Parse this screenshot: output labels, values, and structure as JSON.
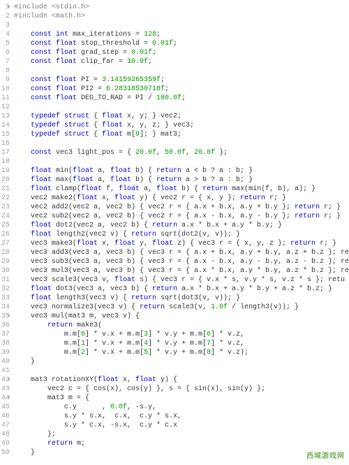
{
  "watermark": "西域游戏网",
  "lines": [
    {
      "n": 1,
      "fold": "▾",
      "html": "<span class='pp'>#include</span> <span class='str'>&lt;stdio.h&gt;</span>"
    },
    {
      "n": 2,
      "fold": "",
      "html": "<span class='pp'>#include</span> <span class='str'>&lt;math.h&gt;</span>"
    },
    {
      "n": 3,
      "fold": "",
      "html": ""
    },
    {
      "n": 4,
      "fold": "",
      "html": "    <span class='kw'>const</span> <span class='type'>int</span> max_iterations = <span class='num'>128</span>;"
    },
    {
      "n": 5,
      "fold": "",
      "html": "    <span class='kw'>const</span> <span class='type'>float</span> stop_threshold = <span class='num'>0.01f</span>;"
    },
    {
      "n": 6,
      "fold": "",
      "html": "    <span class='kw'>const</span> <span class='type'>float</span> grad_step = <span class='num'>0.01f</span>;"
    },
    {
      "n": 7,
      "fold": "",
      "html": "    <span class='kw'>const</span> <span class='type'>float</span> clip_far = <span class='num'>10.0f</span>;"
    },
    {
      "n": 8,
      "fold": "",
      "html": ""
    },
    {
      "n": 9,
      "fold": "",
      "html": "    <span class='kw'>const</span> <span class='type'>float</span> PI = <span class='num'>3.14159265359f</span>;"
    },
    {
      "n": 10,
      "fold": "",
      "html": "    <span class='kw'>const</span> <span class='type'>float</span> PI2 = <span class='num'>6.28318530718f</span>;"
    },
    {
      "n": 11,
      "fold": "",
      "html": "    <span class='kw'>const</span> <span class='type'>float</span> DEG_TO_RAD = PI / <span class='num'>180.0f</span>;"
    },
    {
      "n": 12,
      "fold": "",
      "html": ""
    },
    {
      "n": 13,
      "fold": "",
      "html": "    <span class='kw'>typedef</span> <span class='kw'>struct</span> { <span class='type'>float</span> x, y; } vec2;"
    },
    {
      "n": 14,
      "fold": "",
      "html": "    <span class='kw'>typedef</span> <span class='kw'>struct</span> { <span class='type'>float</span> x, y, z; } vec3;"
    },
    {
      "n": 15,
      "fold": "",
      "html": "    <span class='kw'>typedef</span> <span class='kw'>struct</span> { <span class='type'>float</span> m[<span class='num'>9</span>]; } mat3;"
    },
    {
      "n": 16,
      "fold": "",
      "html": ""
    },
    {
      "n": 17,
      "fold": "",
      "html": "    <span class='kw'>const</span> vec3 light_pos = { <span class='num'>20.0f</span>, <span class='num'>50.0f</span>, <span class='num'>20.0f</span> };"
    },
    {
      "n": 18,
      "fold": "",
      "html": ""
    },
    {
      "n": 19,
      "fold": "",
      "html": "    <span class='type'>float</span> min(<span class='type'>float</span> a, <span class='type'>float</span> b) { <span class='kw'>return</span> a &lt; b ? a : b; }"
    },
    {
      "n": 20,
      "fold": "",
      "html": "    <span class='type'>float</span> max(<span class='type'>float</span> a, <span class='type'>float</span> b) { <span class='kw'>return</span> a &gt; b ? a : b; }"
    },
    {
      "n": 21,
      "fold": "",
      "html": "    <span class='type'>float</span> clamp(<span class='type'>float</span> f, <span class='type'>float</span> a, <span class='type'>float</span> b) { <span class='kw'>return</span> max(min(f, b), a); }"
    },
    {
      "n": 22,
      "fold": "",
      "html": "    vec2 make2(<span class='type'>float</span> x, <span class='type'>float</span> y) { vec2 r = { x, y }; <span class='kw'>return</span> r; }"
    },
    {
      "n": 23,
      "fold": "",
      "html": "    vec2 add2(vec2 a, vec2 b) { vec2 r = { a.x + b.x, a.y + b.y }; <span class='kw'>return</span> r; }"
    },
    {
      "n": 24,
      "fold": "",
      "html": "    vec2 sub2(vec2 a, vec2 b) { vec2 r = { a.x - b.x, a.y - b.y }; <span class='kw'>return</span> r; }"
    },
    {
      "n": 25,
      "fold": "",
      "html": "    <span class='type'>float</span> dot2(vec2 a, vec2 b) { <span class='kw'>return</span> a.x * b.x + a.y * b.y; }"
    },
    {
      "n": 26,
      "fold": "",
      "html": "    <span class='type'>float</span> length2(vec2 v) { <span class='kw'>return</span> sqrt(dot2(v, v)); }"
    },
    {
      "n": 27,
      "fold": "",
      "html": "    vec3 make3(<span class='type'>float</span> x, <span class='type'>float</span> y, <span class='type'>float</span> z) { vec3 r = { x, y, z }; <span class='kw'>return</span> r; }"
    },
    {
      "n": 28,
      "fold": "",
      "html": "    vec3 add3(vec3 a, vec3 b) { vec3 r = { a.x + b.x, a.y + b.y, a.z + b.z }; re"
    },
    {
      "n": 29,
      "fold": "",
      "html": "    vec3 sub3(vec3 a, vec3 b) { vec3 r = { a.x - b.x, a.y - b.y, a.z - b.z }; re"
    },
    {
      "n": 30,
      "fold": "",
      "html": "    vec3 mul3(vec3 a, vec3 b) { vec3 r = { a.x * b.x, a.y * b.y, a.z * b.z }; re"
    },
    {
      "n": 31,
      "fold": "",
      "html": "    vec3 scale3(vec3 v, <span class='type'>float</span> s) { vec3 r = { v.x * s, v.y * s, v.z * s }; retu"
    },
    {
      "n": 32,
      "fold": "",
      "html": "    <span class='type'>float</span> dot3(vec3 a, vec3 b) { <span class='kw'>return</span> a.x * b.x + a.y * b.y + a.z * b.z; }"
    },
    {
      "n": 33,
      "fold": "",
      "html": "    <span class='type'>float</span> length3(vec3 v) { <span class='kw'>return</span> sqrt(dot3(v, v)); }"
    },
    {
      "n": 34,
      "fold": "",
      "html": "    vec3 normalize3(vec3 v) { <span class='kw'>return</span> scale3(v, <span class='num'>1.0f</span> / length3(v)); }"
    },
    {
      "n": 35,
      "fold": "▾",
      "html": "    vec3 mul(mat3 m, vec3 v) {"
    },
    {
      "n": 36,
      "fold": "",
      "html": "        <span class='kw'>return</span> make3("
    },
    {
      "n": 37,
      "fold": "",
      "html": "            m.m[<span class='num'>0</span>] * v.x + m.m[<span class='num'>3</span>] * v.y + m.m[<span class='num'>6</span>] * v.z,"
    },
    {
      "n": 38,
      "fold": "",
      "html": "            m.m[<span class='num'>1</span>] * v.x + m.m[<span class='num'>4</span>] * v.y + m.m[<span class='num'>7</span>] * v.z,"
    },
    {
      "n": 39,
      "fold": "",
      "html": "            m.m[<span class='num'>2</span>] * v.x + m.m[<span class='num'>5</span>] * v.y + m.m[<span class='num'>8</span>] * v.z);"
    },
    {
      "n": 40,
      "fold": "",
      "html": "    }"
    },
    {
      "n": 41,
      "fold": "",
      "html": ""
    },
    {
      "n": 42,
      "fold": "▾",
      "html": "    mat3 rotationXY(<span class='type'>float</span> x, <span class='type'>float</span> y) {"
    },
    {
      "n": 43,
      "fold": "",
      "html": "        vec2 c = { cos(x), cos(y) }, s = { sin(x), sin(y) };"
    },
    {
      "n": 44,
      "fold": "▾",
      "html": "        mat3 m = {"
    },
    {
      "n": 45,
      "fold": "",
      "html": "            c.y      , <span class='num'>0.0f</span>, -s.y,"
    },
    {
      "n": 46,
      "fold": "",
      "html": "            s.y * s.x,  c.x,  c.y * s.x,"
    },
    {
      "n": 47,
      "fold": "",
      "html": "            s.y * c.x, -s.x,  c.y * c.x"
    },
    {
      "n": 48,
      "fold": "",
      "html": "        };"
    },
    {
      "n": 49,
      "fold": "",
      "html": "        <span class='kw'>return</span> m;"
    },
    {
      "n": 50,
      "fold": "",
      "html": "    }"
    }
  ]
}
